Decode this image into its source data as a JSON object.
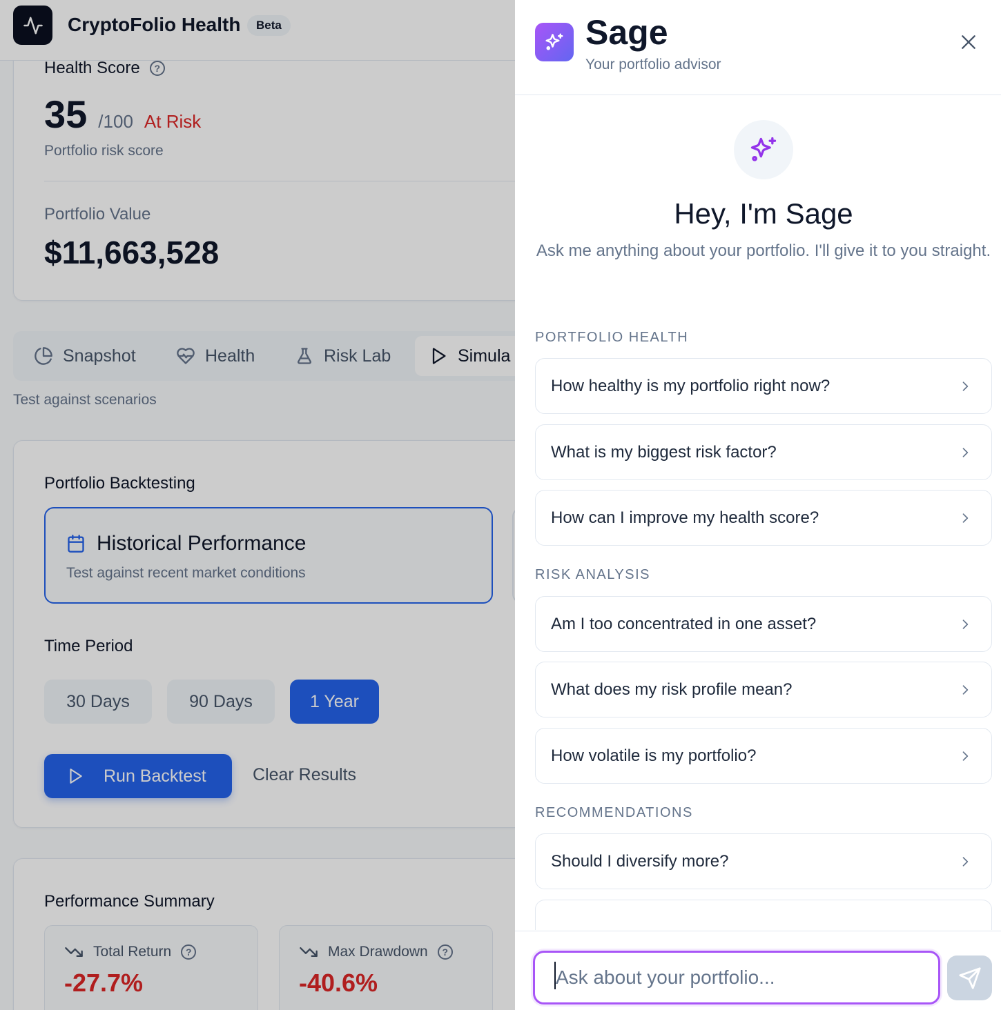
{
  "app": {
    "title": "CryptoFolio Health",
    "badge": "Beta"
  },
  "health": {
    "label": "Health Score",
    "help_glyph": "?",
    "score": "35",
    "max": "/100",
    "status": "At Risk",
    "subtitle": "Portfolio risk score",
    "value_label": "Portfolio Value",
    "value": "$11,663,528"
  },
  "tabs": [
    {
      "label": "Snapshot",
      "icon": "pie-chart-icon"
    },
    {
      "label": "Health",
      "icon": "heart-pulse-icon"
    },
    {
      "label": "Risk Lab",
      "icon": "flask-icon"
    },
    {
      "label": "Simula",
      "icon": "play-icon",
      "active": true
    }
  ],
  "tab_description": "Test against scenarios",
  "backtest": {
    "title": "Portfolio Backtesting",
    "scenario_title": "Historical Performance",
    "scenario_desc": "Test against recent market conditions",
    "period_label": "Time Period",
    "periods": [
      "30 Days",
      "90 Days",
      "1 Year"
    ],
    "selected_period": "1 Year",
    "run_label": "Run Backtest",
    "clear_label": "Clear Results"
  },
  "performance": {
    "title": "Performance Summary",
    "metrics": [
      {
        "label": "Total Return",
        "value": "-27.7%"
      },
      {
        "label": "Max Drawdown",
        "value": "-40.6%"
      }
    ]
  },
  "sage": {
    "name": "Sage",
    "subtitle": "Your portfolio advisor",
    "greeting": "Hey, I'm Sage",
    "intro": "Ask me anything about your portfolio. I'll give it to you straight.",
    "sections": [
      {
        "label": "PORTFOLIO HEALTH",
        "questions": [
          "How healthy is my portfolio right now?",
          "What is my biggest risk factor?",
          "How can I improve my health score?"
        ]
      },
      {
        "label": "RISK ANALYSIS",
        "questions": [
          "Am I too concentrated in one asset?",
          "What does my risk profile mean?",
          "How volatile is my portfolio?"
        ]
      },
      {
        "label": "RECOMMENDATIONS",
        "questions": [
          "Should I diversify more?"
        ]
      }
    ],
    "input_placeholder": "Ask about your portfolio...",
    "accent_color": "#a855f7"
  },
  "colors": {
    "primary": "#2563eb",
    "danger": "#dc2626"
  }
}
